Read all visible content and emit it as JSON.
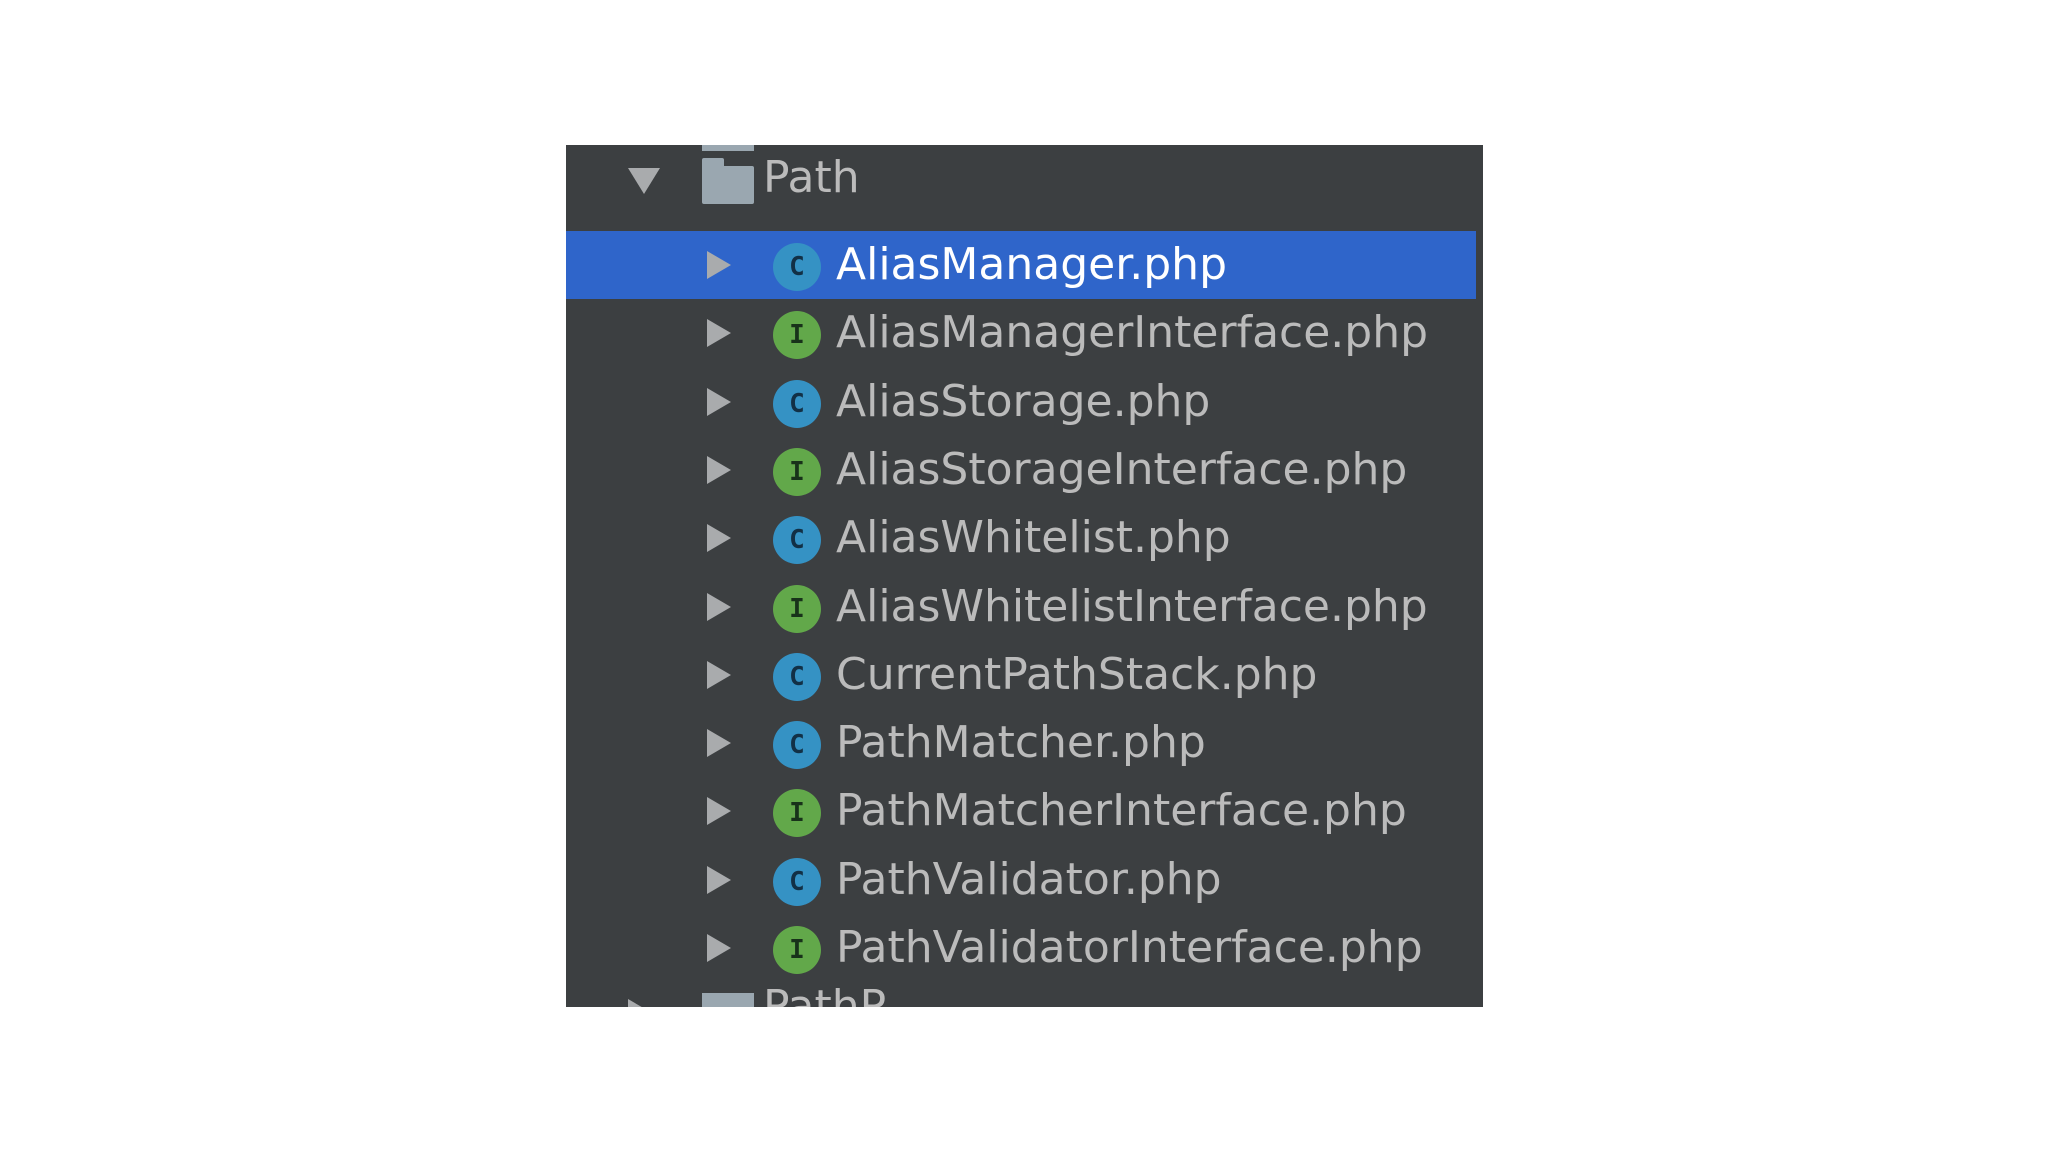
{
  "tree": {
    "folder": {
      "label": "Path",
      "expanded": true,
      "icon": "folder-icon"
    },
    "items": [
      {
        "name": "AliasManager.php",
        "kind": "class",
        "badge": "C",
        "selected": true
      },
      {
        "name": "AliasManagerInterface.php",
        "kind": "interface",
        "badge": "I",
        "selected": false
      },
      {
        "name": "AliasStorage.php",
        "kind": "class",
        "badge": "C",
        "selected": false
      },
      {
        "name": "AliasStorageInterface.php",
        "kind": "interface",
        "badge": "I",
        "selected": false
      },
      {
        "name": "AliasWhitelist.php",
        "kind": "class",
        "badge": "C",
        "selected": false
      },
      {
        "name": "AliasWhitelistInterface.php",
        "kind": "interface",
        "badge": "I",
        "selected": false
      },
      {
        "name": "CurrentPathStack.php",
        "kind": "class",
        "badge": "C",
        "selected": false
      },
      {
        "name": "PathMatcher.php",
        "kind": "class",
        "badge": "C",
        "selected": false
      },
      {
        "name": "PathMatcherInterface.php",
        "kind": "interface",
        "badge": "I",
        "selected": false
      },
      {
        "name": "PathValidator.php",
        "kind": "class",
        "badge": "C",
        "selected": false
      },
      {
        "name": "PathValidatorInterface.php",
        "kind": "interface",
        "badge": "I",
        "selected": false
      }
    ],
    "next_folder_partial": "PathP"
  },
  "colors": {
    "panel_bg": "#3c3f41",
    "selection": "#2f65ca",
    "text": "#bbbbbb",
    "class_badge": "#3592c4",
    "interface_badge": "#62a84a"
  }
}
